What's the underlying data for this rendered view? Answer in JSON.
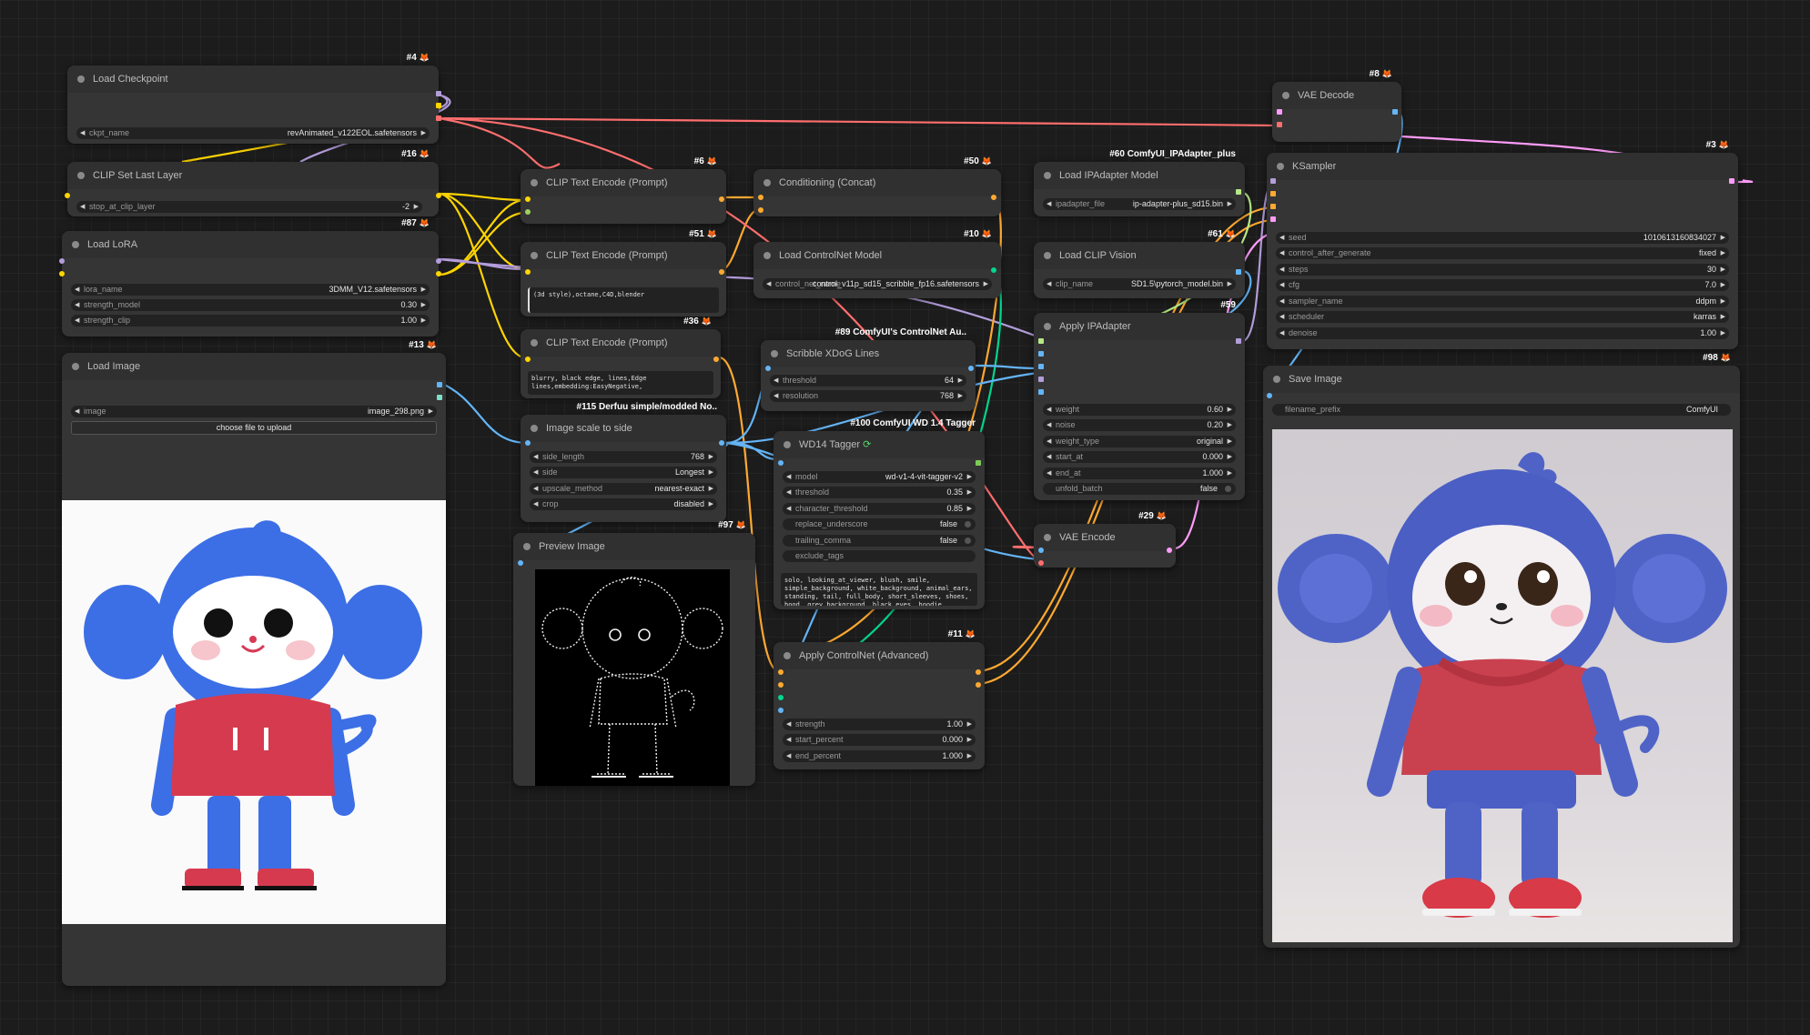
{
  "nodes": {
    "load_checkpoint": {
      "id": "#4",
      "title": "Load Checkpoint",
      "widgets": [
        {
          "label": "ckpt_name",
          "value": "revAnimated_v122EOL.safetensors"
        }
      ]
    },
    "clip_set_last_layer": {
      "id": "#16",
      "title": "CLIP Set Last Layer",
      "widgets": [
        {
          "label": "stop_at_clip_layer",
          "value": "-2"
        }
      ]
    },
    "load_lora": {
      "id": "#87",
      "title": "Load LoRA",
      "widgets": [
        {
          "label": "lora_name",
          "value": "3DMM_V12.safetensors"
        },
        {
          "label": "strength_model",
          "value": "0.30"
        },
        {
          "label": "strength_clip",
          "value": "1.00"
        }
      ]
    },
    "load_image": {
      "id": "#13",
      "title": "Load Image",
      "widgets": [
        {
          "label": "image",
          "value": "image_298.png"
        }
      ],
      "upload_label": "choose file to upload"
    },
    "clip_text_pos_a": {
      "id": "#6",
      "title": "CLIP Text Encode (Prompt)"
    },
    "clip_text_pos_b": {
      "id": "#51",
      "title": "CLIP Text Encode (Prompt)",
      "text": "(3d style),octane,C4D,blender"
    },
    "clip_text_neg": {
      "id": "#36",
      "title": "CLIP Text Encode (Prompt)",
      "text": "blurry, black edge, lines,Edge lines,embedding:EasyNegative,"
    },
    "image_scale": {
      "id": "#115 Derfuu simple/modded No..",
      "title": "Image scale to side",
      "widgets": [
        {
          "label": "side_length",
          "value": "768"
        },
        {
          "label": "side",
          "value": "Longest"
        },
        {
          "label": "upscale_method",
          "value": "nearest-exact"
        },
        {
          "label": "crop",
          "value": "disabled"
        }
      ]
    },
    "preview_image": {
      "id": "#97",
      "title": "Preview Image"
    },
    "conditioning_concat": {
      "id": "#50",
      "title": "Conditioning (Concat)"
    },
    "load_controlnet": {
      "id": "#10",
      "title": "Load ControlNet Model",
      "widgets": [
        {
          "label": "control_net_name",
          "value": "control_v11p_sd15_scribble_fp16.safetensors"
        }
      ]
    },
    "scribble_xdog": {
      "id": "#89 ComfyUI's ControlNet Au..",
      "title": "Scribble XDoG Lines",
      "widgets": [
        {
          "label": "threshold",
          "value": "64"
        },
        {
          "label": "resolution",
          "value": "768"
        }
      ]
    },
    "wd14_tagger": {
      "id": "#100 ComfyUI WD 1.4 Tagger",
      "title": "WD14 Tagger",
      "widgets": [
        {
          "label": "model",
          "value": "wd-v1-4-vit-tagger-v2"
        },
        {
          "label": "threshold",
          "value": "0.35"
        },
        {
          "label": "character_threshold",
          "value": "0.85"
        }
      ],
      "toggles": [
        {
          "label": "replace_underscore",
          "value": "false"
        },
        {
          "label": "trailing_comma",
          "value": "false"
        }
      ],
      "exclude_label": "exclude_tags",
      "tags": "solo, looking_at_viewer, blush, smile, simple_background, white_background, animal_ears, standing, tail, full_body, short_sleeves, shoes, hood, grey_background, black_eyes, hoodie,"
    },
    "apply_controlnet": {
      "id": "#11",
      "title": "Apply ControlNet (Advanced)",
      "widgets": [
        {
          "label": "strength",
          "value": "1.00"
        },
        {
          "label": "start_percent",
          "value": "0.000"
        },
        {
          "label": "end_percent",
          "value": "1.000"
        }
      ]
    },
    "load_ipadapter": {
      "id": "#60 ComfyUI_IPAdapter_plus",
      "title": "Load IPAdapter Model",
      "widgets": [
        {
          "label": "ipadapter_file",
          "value": "ip-adapter-plus_sd15.bin"
        }
      ]
    },
    "load_clip_vision": {
      "id": "#61",
      "title": "Load CLIP Vision",
      "widgets": [
        {
          "label": "clip_name",
          "value": "SD1.5\\pytorch_model.bin"
        }
      ]
    },
    "apply_ipadapter": {
      "id": "#59",
      "title": "Apply IPAdapter",
      "widgets": [
        {
          "label": "weight",
          "value": "0.60"
        },
        {
          "label": "noise",
          "value": "0.20"
        },
        {
          "label": "weight_type",
          "value": "original"
        },
        {
          "label": "start_at",
          "value": "0.000"
        },
        {
          "label": "end_at",
          "value": "1.000"
        }
      ],
      "toggles": [
        {
          "label": "unfold_batch",
          "value": "false"
        }
      ]
    },
    "vae_encode": {
      "id": "#29",
      "title": "VAE Encode"
    },
    "vae_decode": {
      "id": "#8",
      "title": "VAE Decode"
    },
    "ksampler": {
      "id": "#3",
      "title": "KSampler",
      "widgets": [
        {
          "label": "seed",
          "value": "1010613160834027"
        },
        {
          "label": "control_after_generate",
          "value": "fixed"
        },
        {
          "label": "steps",
          "value": "30"
        },
        {
          "label": "cfg",
          "value": "7.0"
        },
        {
          "label": "sampler_name",
          "value": "ddpm"
        },
        {
          "label": "scheduler",
          "value": "karras"
        },
        {
          "label": "denoise",
          "value": "1.00"
        }
      ]
    },
    "save_image": {
      "id": "#98",
      "title": "Save Image",
      "widgets": [
        {
          "label": "filename_prefix",
          "value": "ComfyUI"
        }
      ]
    }
  },
  "colors": {
    "model": "#b39ddb",
    "clip": "#ffd500",
    "vae": "#ff6e6e",
    "conditioning": "#ffa931",
    "image": "#64b5f6",
    "latent": "#ff9cf9",
    "control_net": "#00d78d",
    "ipadapter": "#b8e986"
  }
}
